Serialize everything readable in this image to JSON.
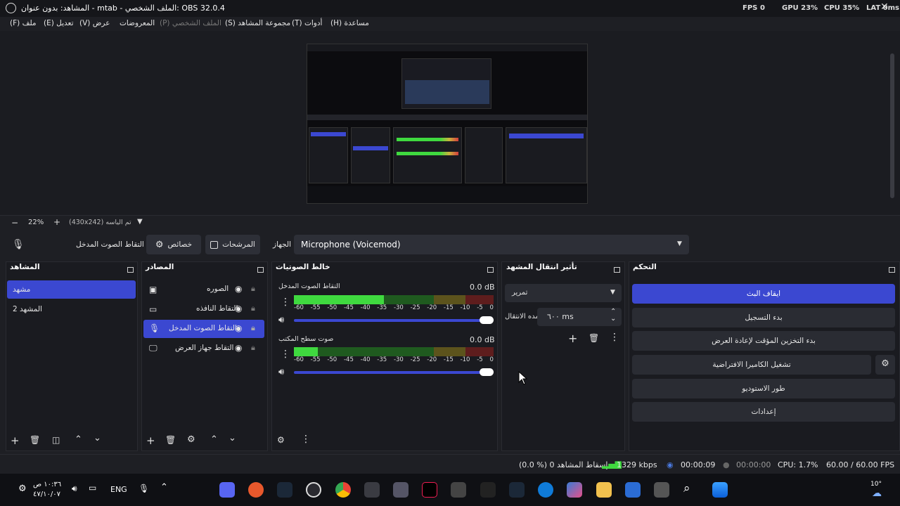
{
  "window": {
    "title": "المشاهد: بدون عنوان - mtab - الملف الشخصي: OBS 32.0.4",
    "stats": {
      "fps_label": "FPS",
      "fps": "0",
      "gpu": "GPU 23%",
      "cpu": "CPU 35%",
      "lat": "LAT 0ms"
    }
  },
  "menu": [
    "(F) ملف",
    "(E) تعديل",
    "(V) عرض",
    "المعروضات",
    "(P) الملف الشخصي",
    "(S) مجموعة المشاهد",
    "(T) أدوات",
    "(H) مساعدة"
  ],
  "zoom": {
    "percent": "22%",
    "size": "(430x242) تم الياسه"
  },
  "source_toolbar": {
    "source_name": "التقاط الصوت المدخل",
    "properties": "خصائص",
    "filters": "المرشحات",
    "device_label": "الجهاز",
    "device_value": "Microphone (Voicemod)"
  },
  "scenes": {
    "title": "المشاهد",
    "items": [
      "مشهد",
      "المشهد 2"
    ]
  },
  "sources": {
    "title": "المصادر",
    "items": [
      "الصوره",
      "التقاط النافذه",
      "التقاط الصوت المدخل",
      "التقاط جهاز العرض"
    ]
  },
  "mixer": {
    "title": "خالط الصوتيات",
    "channels": [
      {
        "name": "التقاط الصوت المدخل",
        "db": "0.0 dB",
        "level": 0.45
      },
      {
        "name": "صوت سطح المكتب",
        "db": "0.0 dB",
        "level": 0.12
      }
    ],
    "ticks": [
      "-60",
      "-55",
      "-50",
      "-45",
      "-40",
      "-35",
      "-30",
      "-25",
      "-20",
      "-15",
      "-10",
      "-5",
      "0"
    ]
  },
  "transitions": {
    "title": "تأثير انتقال المشهد",
    "type": "تمرير",
    "duration_label": "مده الانتقال",
    "duration_value": "٦٠٠ ms"
  },
  "controls": {
    "title": "التحكم",
    "buttons": [
      "ايقاف البث",
      "بدء التسجيل",
      "بدء التخزين المؤقت لإعادة العرض",
      "تشغيل الكاميرا الافتراضية",
      "طور الاستوديو",
      "إعدادات"
    ]
  },
  "status": {
    "dropped": "(0.0 %) 0 إسقاط المشاهد",
    "kbps": "1329 kbps",
    "stream_time": "00:00:09",
    "rec_time": "00:00:00",
    "cpu": "CPU: 1.7%",
    "fps": "60.00 / 60.00 FPS"
  },
  "taskbar": {
    "time": "١٠:٣٦ ص",
    "date": "٤٧/١٠/٠٧",
    "lang": "ENG",
    "temp": "10°"
  },
  "colors": {
    "accent": "#3b48d1",
    "meter_green": "#3fd93f",
    "meter_yellow": "#c9b43c",
    "meter_red": "#d53c3c"
  }
}
